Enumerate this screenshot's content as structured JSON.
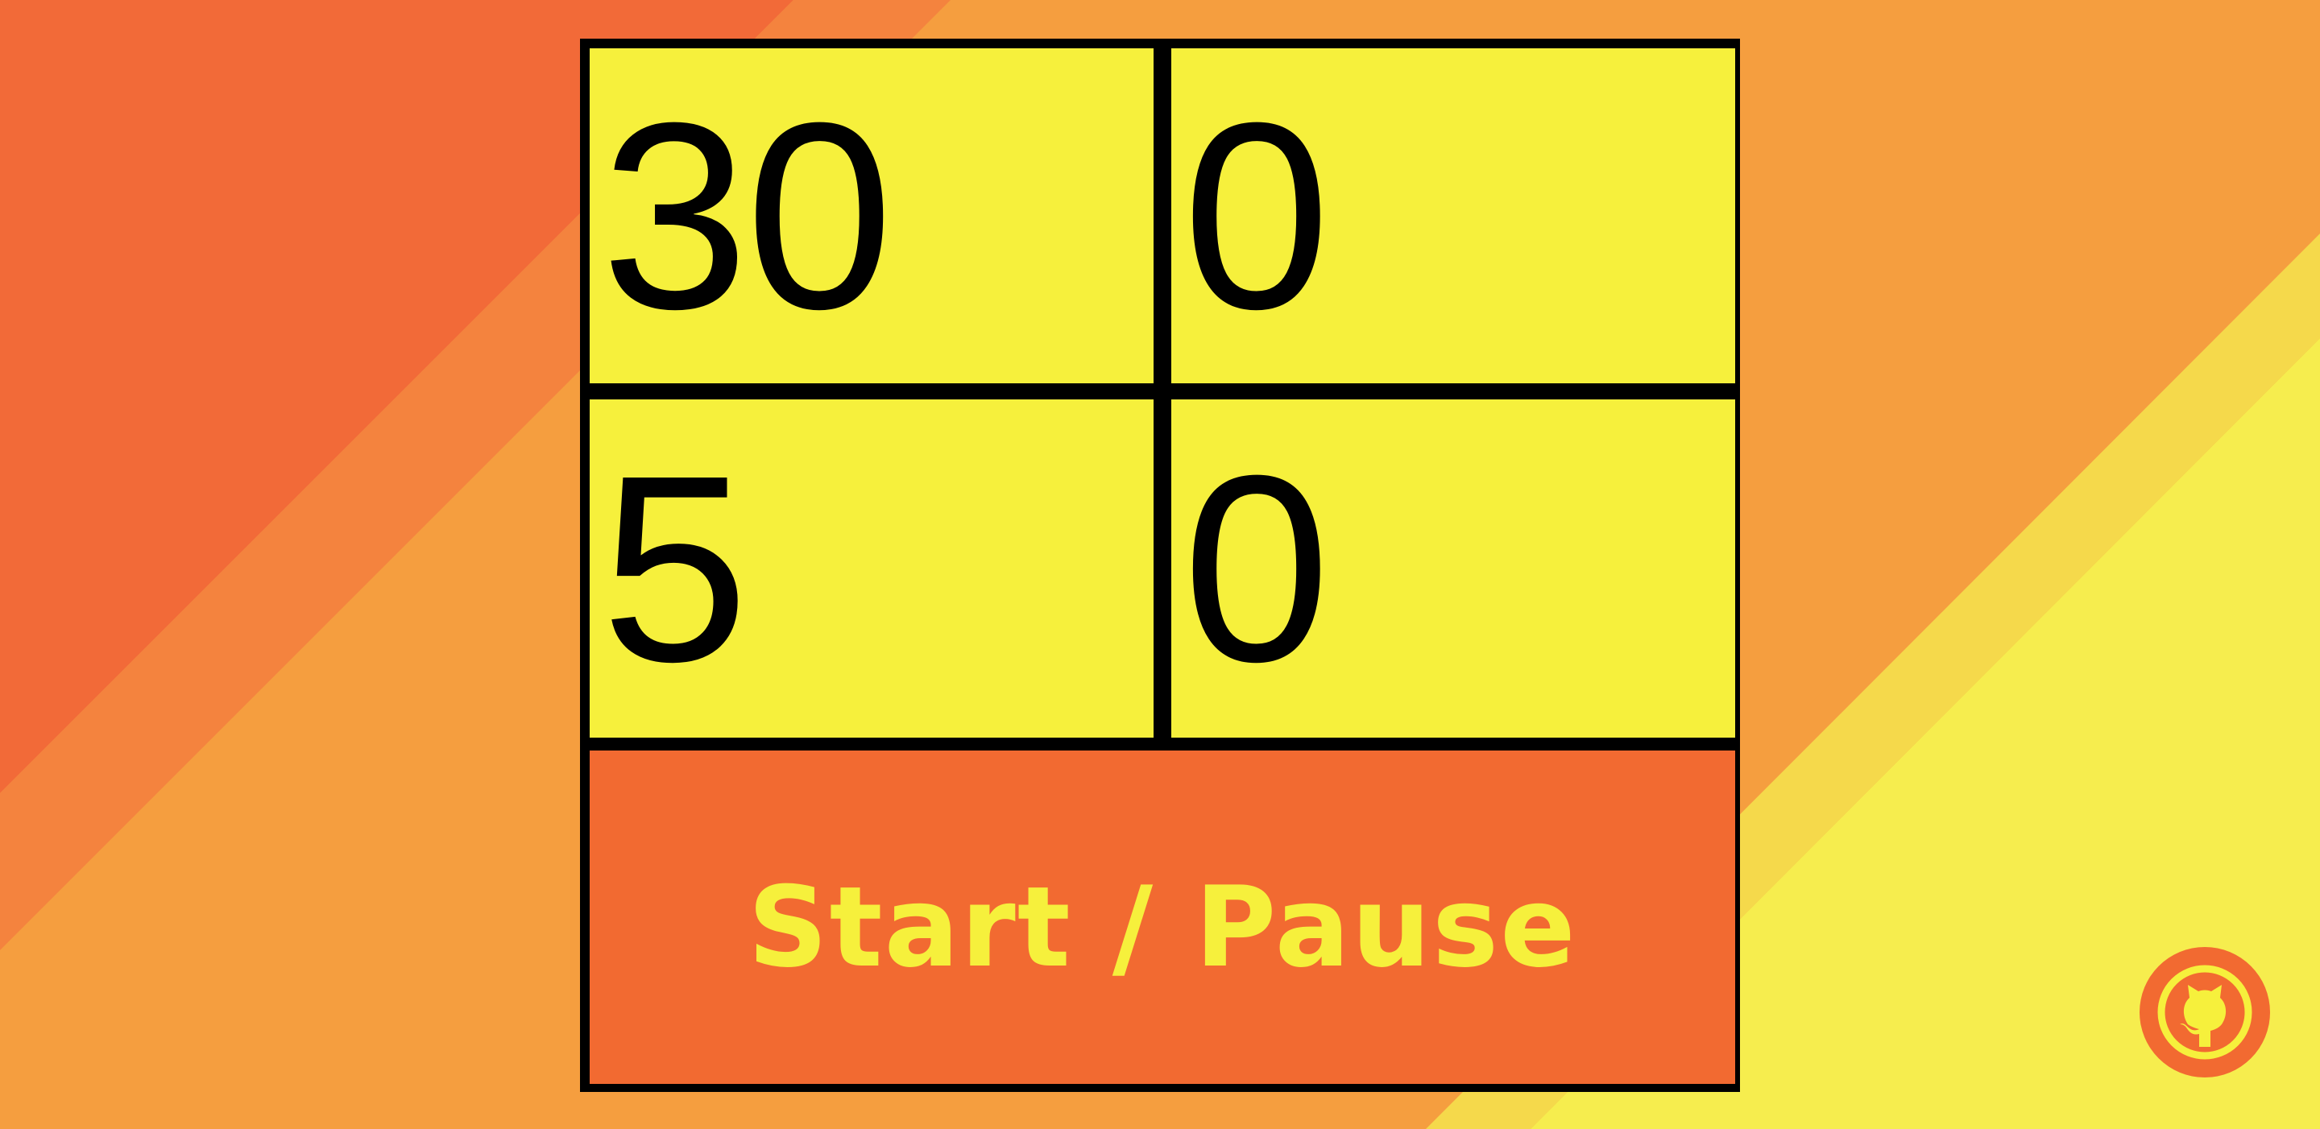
{
  "colors": {
    "background_dark": "#f26a38",
    "background_mid": "#f4833e",
    "background_light": "#f59e3f",
    "background_yellow": "#f5d94b",
    "cell": "#f6f03c",
    "button": "#f26a31",
    "button_text": "#f6f03c",
    "border": "#000000"
  },
  "timer": {
    "cells": [
      {
        "value": "30"
      },
      {
        "value": "0"
      },
      {
        "value": "5"
      },
      {
        "value": "0"
      }
    ]
  },
  "controls": {
    "start_pause_label": "Start / Pause"
  },
  "footer": {
    "github_icon": "github-icon"
  }
}
